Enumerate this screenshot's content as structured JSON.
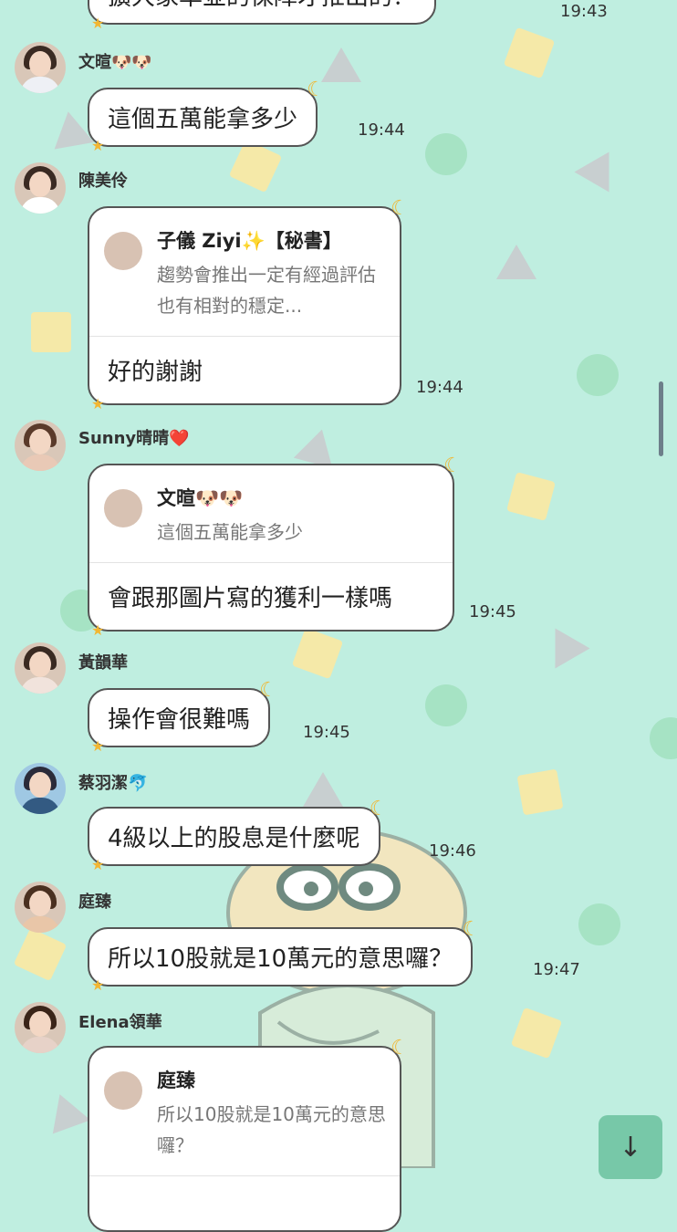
{
  "top_cut": {
    "text": "擴大家準並的保障才推出的？",
    "time": "19:43"
  },
  "messages": [
    {
      "sender": "文暄🐶🐶",
      "text": "這個五萬能拿多少",
      "time": "19:44"
    },
    {
      "sender": "陳美伶",
      "quote_name": "子儀 Ziyi✨【秘書】",
      "quote_text": "趨勢會推出一定有經過評估也有相對的穩定...",
      "text": "好的謝謝",
      "time": "19:44"
    },
    {
      "sender": "Sunny晴晴❤️",
      "quote_name": "文暄🐶🐶",
      "quote_text": "這個五萬能拿多少",
      "text": "會跟那圖片寫的獲利一樣嗎",
      "time": "19:45"
    },
    {
      "sender": "黃韻華",
      "text": "操作會很難嗎",
      "time": "19:45"
    },
    {
      "sender": "蔡羽潔🐬",
      "text": "4級以上的股息是什麼呢",
      "time": "19:46"
    },
    {
      "sender": "庭臻",
      "text": "所以10股就是10萬元的意思囉？",
      "time": "19:47"
    },
    {
      "sender": "Elena領華",
      "quote_name": "庭臻",
      "quote_text": "所以10股就是10萬元的意思囉？"
    }
  ],
  "scroll_button": {
    "icon": "arrow-down-icon",
    "glyph": "↓"
  },
  "colors": {
    "background": "#bfeee0",
    "accent": "#f2b632"
  }
}
